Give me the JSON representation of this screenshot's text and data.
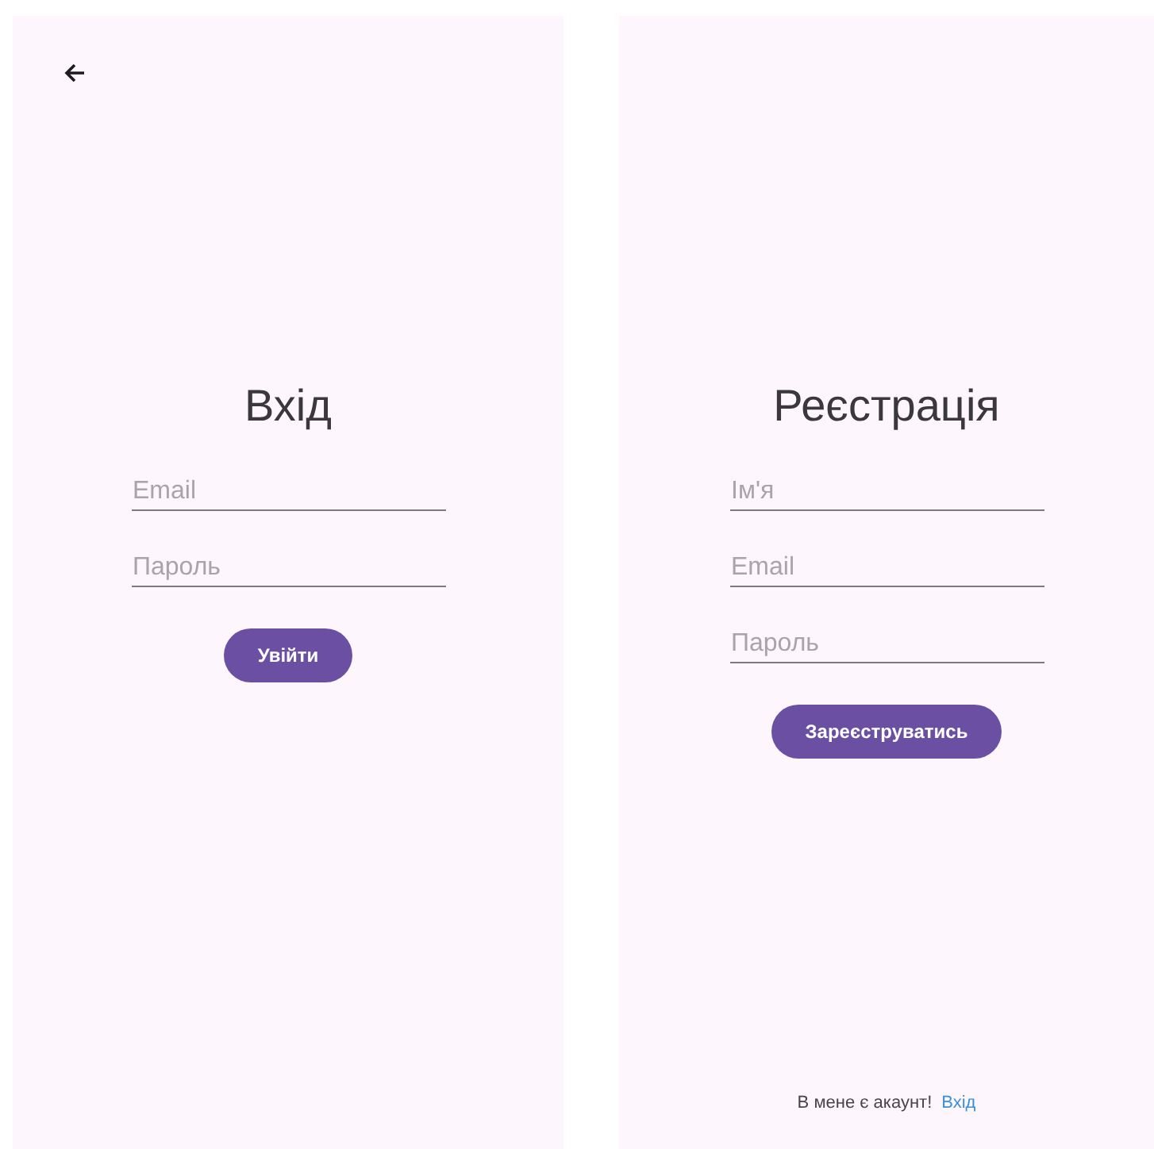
{
  "screens": [
    {
      "back_button": true,
      "title": "Вхід",
      "fields": [
        {
          "placeholder": "Email"
        },
        {
          "placeholder": "Пароль"
        }
      ],
      "button": "Увійти"
    },
    {
      "title": "Реєстрація",
      "fields": [
        {
          "placeholder": "Ім'я"
        },
        {
          "placeholder": "Email"
        },
        {
          "placeholder": "Пароль"
        }
      ],
      "button": "Зареєструватись",
      "footer": {
        "text": "В мене є акаунт!",
        "link": "Вхід"
      }
    }
  ]
}
